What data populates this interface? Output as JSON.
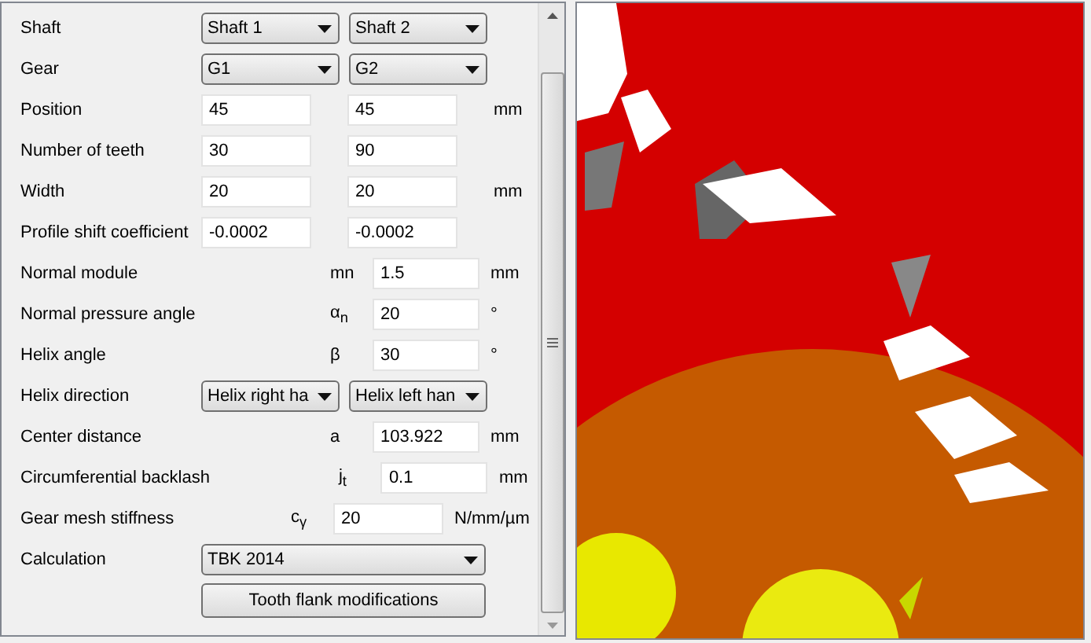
{
  "parameters": {
    "rows": [
      {
        "kind": "combo-pair",
        "label": "Shaft",
        "values": [
          "Shaft 1",
          "Shaft 2"
        ]
      },
      {
        "kind": "combo-pair",
        "label": "Gear",
        "values": [
          "G1",
          "G2"
        ]
      },
      {
        "kind": "field-pair",
        "label": "Position",
        "values": [
          "45",
          "45"
        ],
        "unit": "mm"
      },
      {
        "kind": "field-pair",
        "label": "Number of teeth",
        "values": [
          "30",
          "90"
        ]
      },
      {
        "kind": "field-pair",
        "label": "Width",
        "values": [
          "20",
          "20"
        ],
        "unit": "mm"
      },
      {
        "kind": "field-pair",
        "label": "Profile shift coefficient",
        "values": [
          "-0.0002",
          "-0.0002"
        ]
      },
      {
        "kind": "field",
        "label": "Normal module",
        "symbol": "mn",
        "value": "1.5",
        "unit": "mm"
      },
      {
        "kind": "field",
        "label": "Normal pressure angle",
        "symbol": "α$_{n}$",
        "value": "20",
        "unit": "°"
      },
      {
        "kind": "field",
        "label": "Helix angle",
        "symbol": "β",
        "value": "30",
        "unit": "°"
      },
      {
        "kind": "combo-pair",
        "label": "Helix direction",
        "values": [
          "Helix right ha",
          "Helix left han"
        ]
      },
      {
        "kind": "field",
        "label": "Center distance",
        "symbol": "a",
        "value": "103.922",
        "unit": "mm"
      },
      {
        "kind": "field",
        "label": "Circumferential backlash",
        "symbol": "j$_{t}$",
        "value": "0.1",
        "unit": "mm"
      },
      {
        "kind": "field-long-unit",
        "label": "Gear mesh stiffness",
        "symbol": "c$_{γ}$",
        "value": "20",
        "unit": "N/mm/µm"
      },
      {
        "kind": "combo",
        "label": "Calculation",
        "value": "TBK 2014"
      },
      {
        "kind": "button",
        "label": "Tooth flank modifications"
      }
    ]
  }
}
